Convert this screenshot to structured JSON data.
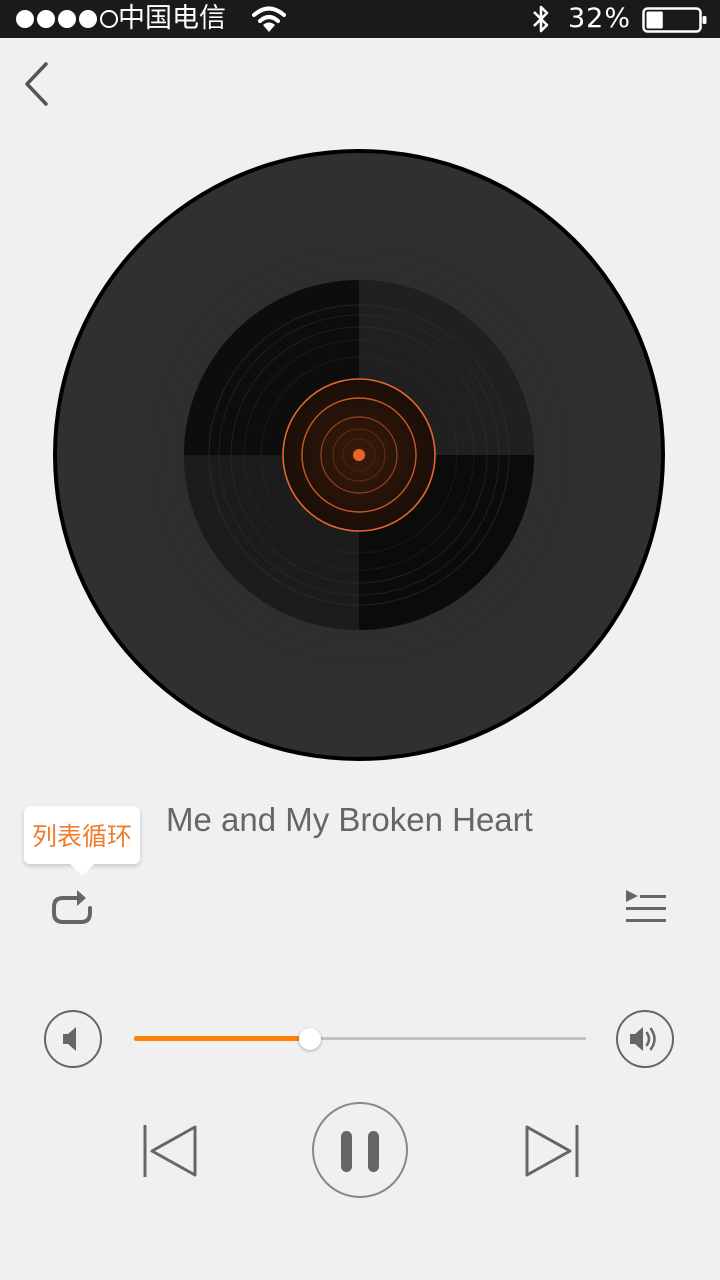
{
  "status_bar": {
    "signal_bars_filled": 4,
    "signal_bars_total": 5,
    "carrier": "中国电信",
    "wifi_icon": "wifi-icon",
    "bluetooth_icon": "bluetooth-icon",
    "battery_percent": "32%",
    "battery_level": 0.32
  },
  "nav": {
    "back_icon": "chevron-left-icon"
  },
  "player": {
    "song_title": "Me and My Broken Heart",
    "play_mode_label": "列表循环",
    "play_mode_icon": "repeat-icon",
    "playlist_icon": "playlist-icon",
    "volume_level": 0.39,
    "is_playing": true,
    "controls": [
      "previous-icon",
      "pause-icon",
      "next-icon"
    ]
  },
  "colors": {
    "accent": "#ff7f0e",
    "tooltip_text": "#ee7d2c",
    "background": "#f0f0f0",
    "status_bar": "#1a1a1a",
    "disc": "#2d2d2d"
  }
}
